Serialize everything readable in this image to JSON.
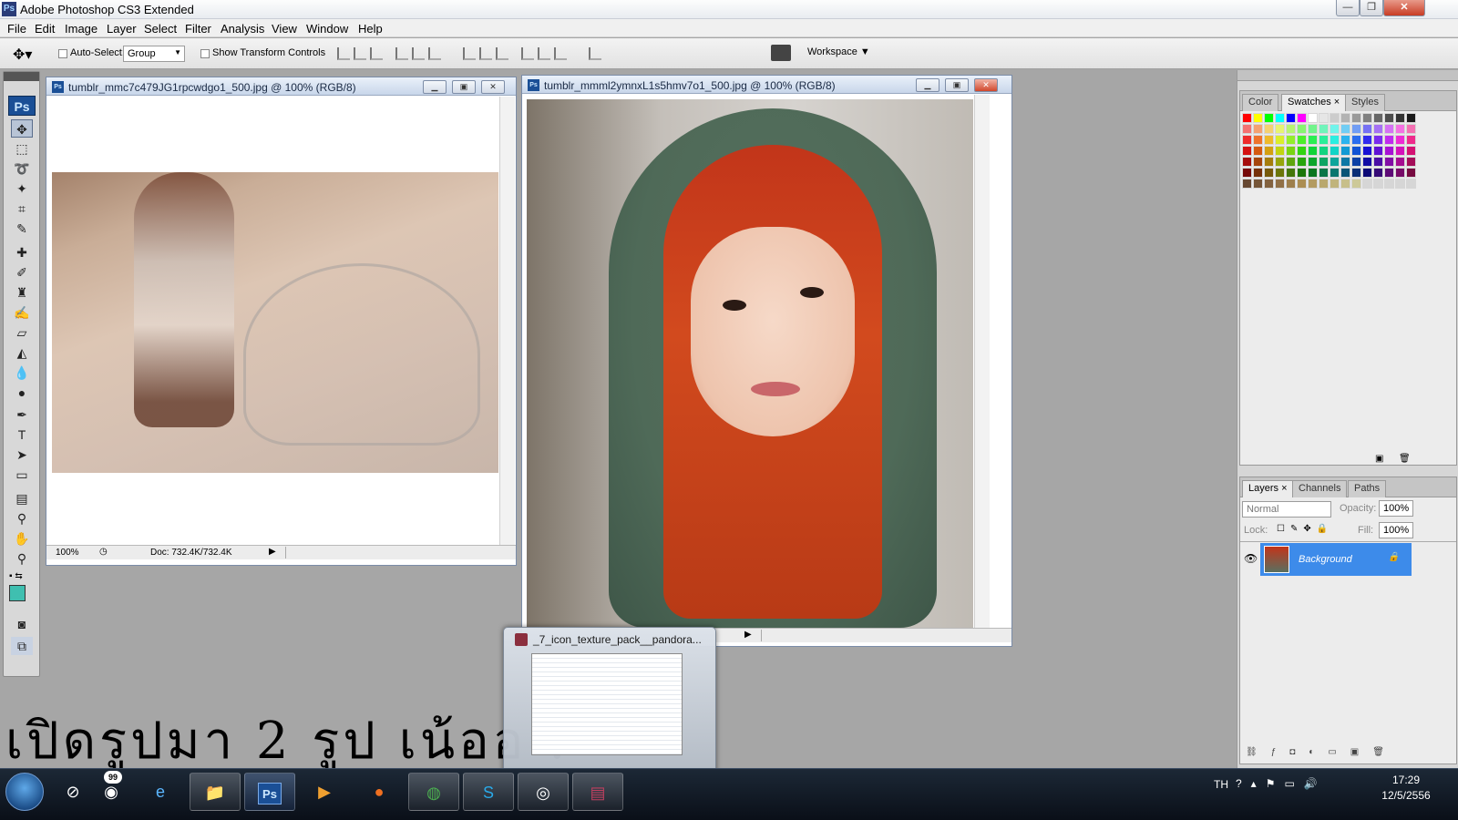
{
  "app": {
    "title": "Adobe Photoshop CS3 Extended"
  },
  "menu": [
    "File",
    "Edit",
    "Image",
    "Layer",
    "Select",
    "Filter",
    "Analysis",
    "View",
    "Window",
    "Help"
  ],
  "options": {
    "auto_select_label": "Auto-Select:",
    "auto_select_value": "Group",
    "show_transform_label": "Show Transform Controls",
    "workspace_label": "Workspace"
  },
  "tools": {
    "logo": "Ps"
  },
  "doc1": {
    "title": "tumblr_mmc7c479JG1rpcwdgo1_500.jpg @ 100% (RGB/8)",
    "zoom": "100%",
    "doc_size": "Doc: 732.4K/732.4K"
  },
  "doc2": {
    "title": "tumblr_mmml2ymnxL1s5hmv7o1_500.jpg @ 100% (RGB/8)"
  },
  "swatch_panel": {
    "tabs": [
      "Color",
      "Swatches",
      "Styles"
    ]
  },
  "layers_panel": {
    "tabs": [
      "Layers",
      "Channels",
      "Paths"
    ],
    "blend_mode": "Normal",
    "opacity_label": "Opacity:",
    "opacity_value": "100%",
    "lock_label": "Lock:",
    "fill_label": "Fill:",
    "fill_value": "100%",
    "layer_name": "Background"
  },
  "thumbnail": {
    "title": "_7_icon_texture_pack__pandora..."
  },
  "caption": "เปิดรูปมา 2 รูป เน้ออ !",
  "taskbar": {
    "badge": "99",
    "lang": "TH",
    "time": "17:29",
    "date": "12/5/2556"
  },
  "colors": {
    "foreground": "#3fbfb0",
    "selection": "#3d8bea",
    "taskbar": "#0f1722"
  }
}
